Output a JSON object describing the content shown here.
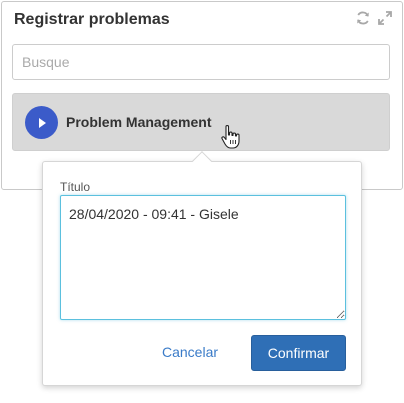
{
  "widget": {
    "title": "Registrar problemas"
  },
  "search": {
    "value": "",
    "placeholder": "Busque"
  },
  "process": {
    "label": "Problem Management"
  },
  "popover": {
    "field_label": "Título",
    "title_value": "28/04/2020 - 09:41 - Gisele",
    "cancel_label": "Cancelar",
    "confirm_label": "Confirmar"
  },
  "icons": {
    "refresh": "refresh-icon",
    "expand": "expand-icon",
    "play": "play-icon",
    "cursor": "hand-pointer-icon"
  },
  "colors": {
    "accent": "#3b5bc9",
    "primary_button": "#2f6fb6",
    "link": "#3a7bc8",
    "focus_border": "#5bc0de",
    "item_background": "#d9d9d9"
  }
}
